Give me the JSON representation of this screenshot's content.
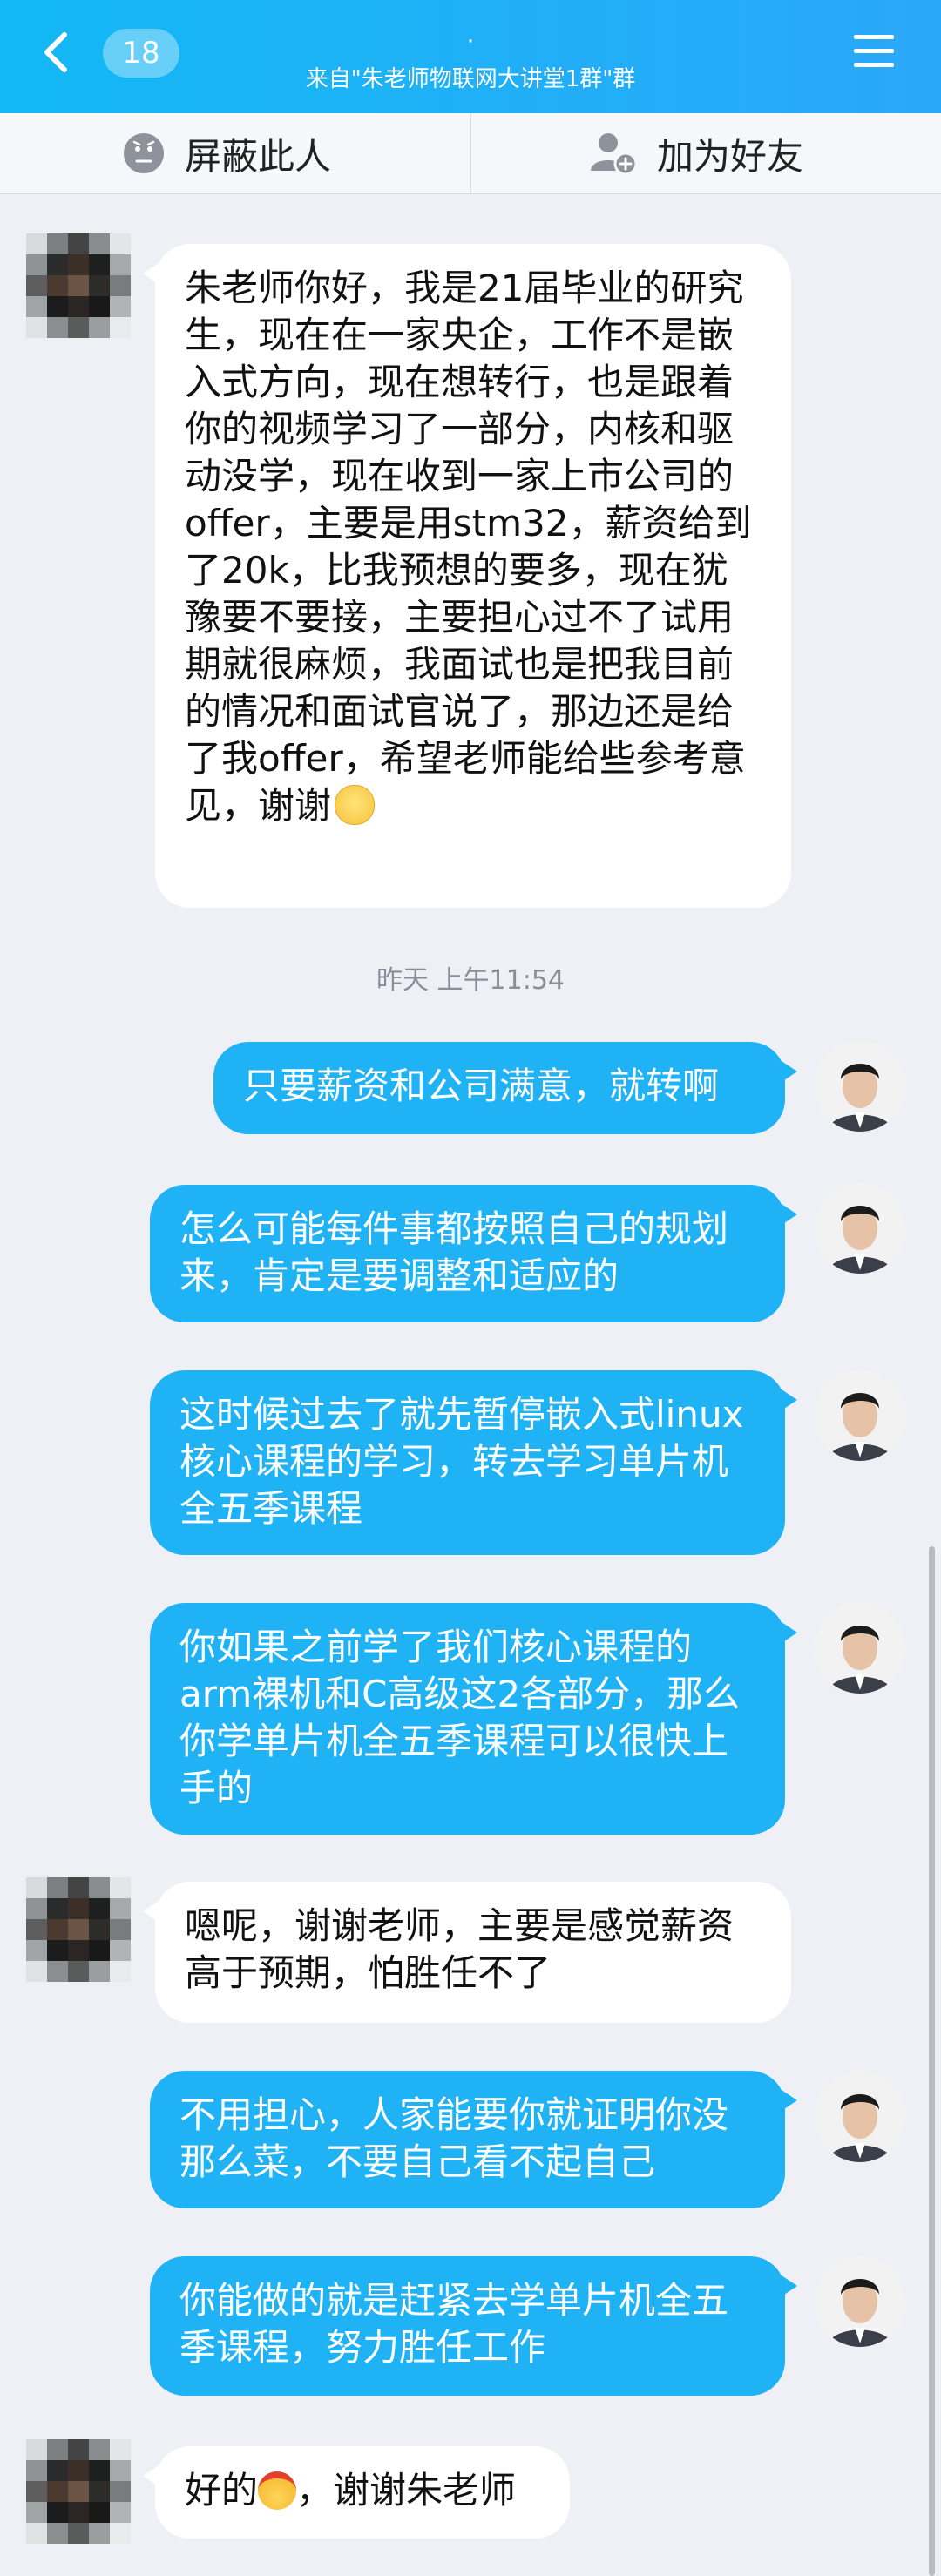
{
  "header": {
    "unread_count": "18",
    "title": "·",
    "subtitle": "来自\"朱老师物联网大讲堂1群\"群"
  },
  "actions": {
    "block_label": "屏蔽此人",
    "add_friend_label": "加为好友"
  },
  "timestamp": "昨天 上午11:54",
  "messages": [
    {
      "from": "other",
      "text": "朱老师你好，我是21届毕业的研究生，现在在一家央企，工作不是嵌入式方向，现在想转行，也是跟着你的视频学习了一部分，内核和驱动没学，现在收到一家上市公司的offer，主要是用stm32，薪资给到了20k，比我预想的要多，现在犹豫要不要接，主要担心过不了试用期就很麻烦，我面试也是把我目前的情况和面试官说了，那边还是给了我offer，希望老师能给些参考意见，谢谢",
      "emoji": "pensive-emoji"
    },
    {
      "from": "me",
      "text": "只要薪资和公司满意，就转啊"
    },
    {
      "from": "me",
      "text": "怎么可能每件事都按照自己的规划来，肯定是要调整和适应的"
    },
    {
      "from": "me",
      "text": "这时候过去了就先暂停嵌入式linux核心课程的学习，转去学习单片机全五季课程"
    },
    {
      "from": "me",
      "text": "你如果之前学了我们核心课程的arm裸机和C高级这2各部分，那么你学单片机全五季课程可以很快上手的"
    },
    {
      "from": "other",
      "text": "嗯呢，谢谢老师，主要是感觉薪资高于预期，怕胜任不了"
    },
    {
      "from": "me",
      "text": "不用担心，人家能要你就证明你没那么菜，不要自己看不起自己"
    },
    {
      "from": "me",
      "text": "你能做的就是赶紧去学单片机全五季课程，努力胜任工作"
    },
    {
      "from": "other",
      "text_before": "好的",
      "text_after": "，谢谢朱老师",
      "emoji": "headband-emoji"
    }
  ],
  "colors": {
    "header": "#1fb0f7",
    "bubble_out": "#1fb2f5",
    "bubble_in": "#ffffff",
    "background": "#eef0f6"
  }
}
